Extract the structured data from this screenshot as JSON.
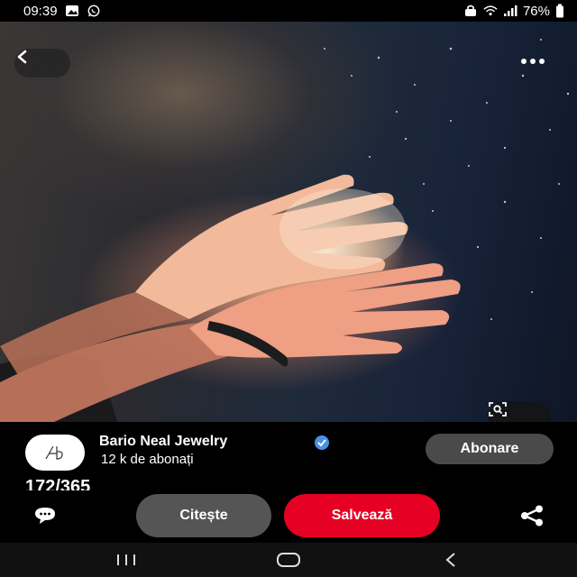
{
  "status_bar": {
    "time": "09:39",
    "battery": "76%",
    "left_icons": [
      "gallery-icon",
      "whatsapp-icon"
    ],
    "right_icons": [
      "vpn-icon",
      "wifi-icon",
      "signal-icon",
      "battery-icon"
    ]
  },
  "pin": {
    "image_icons": [
      "back-icon",
      "more-icon",
      "visual-search-icon"
    ]
  },
  "creator": {
    "name": "Bario Neal Jewelry",
    "followers": "12 k de abonați",
    "follow_label": "Abonare",
    "verified": true
  },
  "pin_counter": "172/365",
  "actions": {
    "read_label": "Citește",
    "save_label": "Salvează",
    "save_color": "#e60023",
    "read_color": "#555555"
  },
  "nav": {
    "items": [
      "recent-apps",
      "home",
      "back"
    ]
  }
}
